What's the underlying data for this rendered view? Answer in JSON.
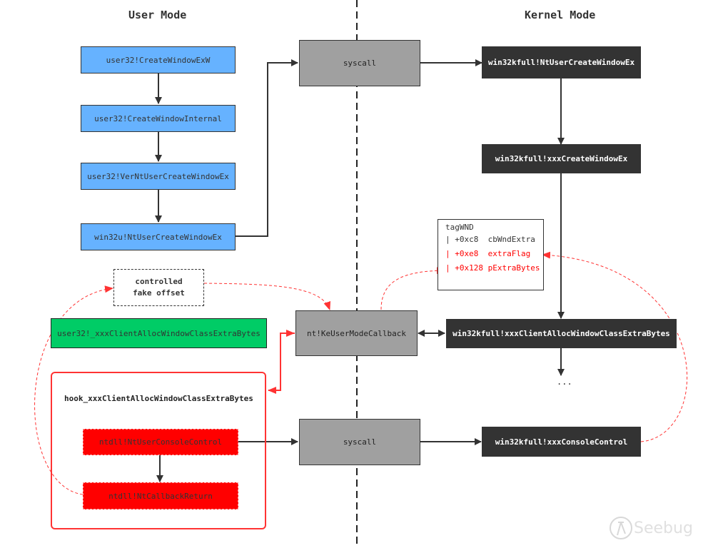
{
  "headings": {
    "user_mode": "User Mode",
    "kernel_mode": "Kernel Mode"
  },
  "user_chain": [
    "user32!CreateWindowExW",
    "user32!CreateWindowInternal",
    "user32!VerNtUserCreateWindowEx",
    "win32u!NtUserCreateWindowEx"
  ],
  "syscall_top": "syscall",
  "syscall_bottom": "syscall",
  "callback": "nt!KeUserModeCallback",
  "kernel_chain": {
    "nt_create": "win32kfull!NtUserCreateWindowEx",
    "xxx_create": "win32kfull!xxxCreateWindowEx",
    "alloc_extra": "win32kfull!xxxClientAllocWindowClassExtraBytes",
    "console_control": "win32kfull!xxxConsoleControl",
    "continuation": "..."
  },
  "fake_offset": {
    "line1": "controlled",
    "line2": "fake offset"
  },
  "user_callback": "user32!_xxxClientAllocWindowClassExtraBytes",
  "hook": {
    "title": "hook_xxxClientAllocWindowClassExtraBytes",
    "console": "ntdll!NtUserConsoleControl",
    "callback_return": "ntdll!NtCallbackReturn"
  },
  "tagwnd": {
    "title": "tagWND",
    "fields": [
      {
        "text": "| +0xc8  cbWndExtra",
        "highlight": false
      },
      {
        "text": "| +0xe8  extraFlag",
        "highlight": true
      },
      {
        "text": "| +0x128 pExtraBytes",
        "highlight": true
      }
    ]
  },
  "watermark": "Seebug",
  "colors": {
    "user_box": "#66b2ff",
    "kernel_box": "#333333",
    "syscall_box": "#a0a0a0",
    "user_callback_box": "#00cc66",
    "hook_box": "#ff0000",
    "exploit_arrow": "#ff0000"
  }
}
